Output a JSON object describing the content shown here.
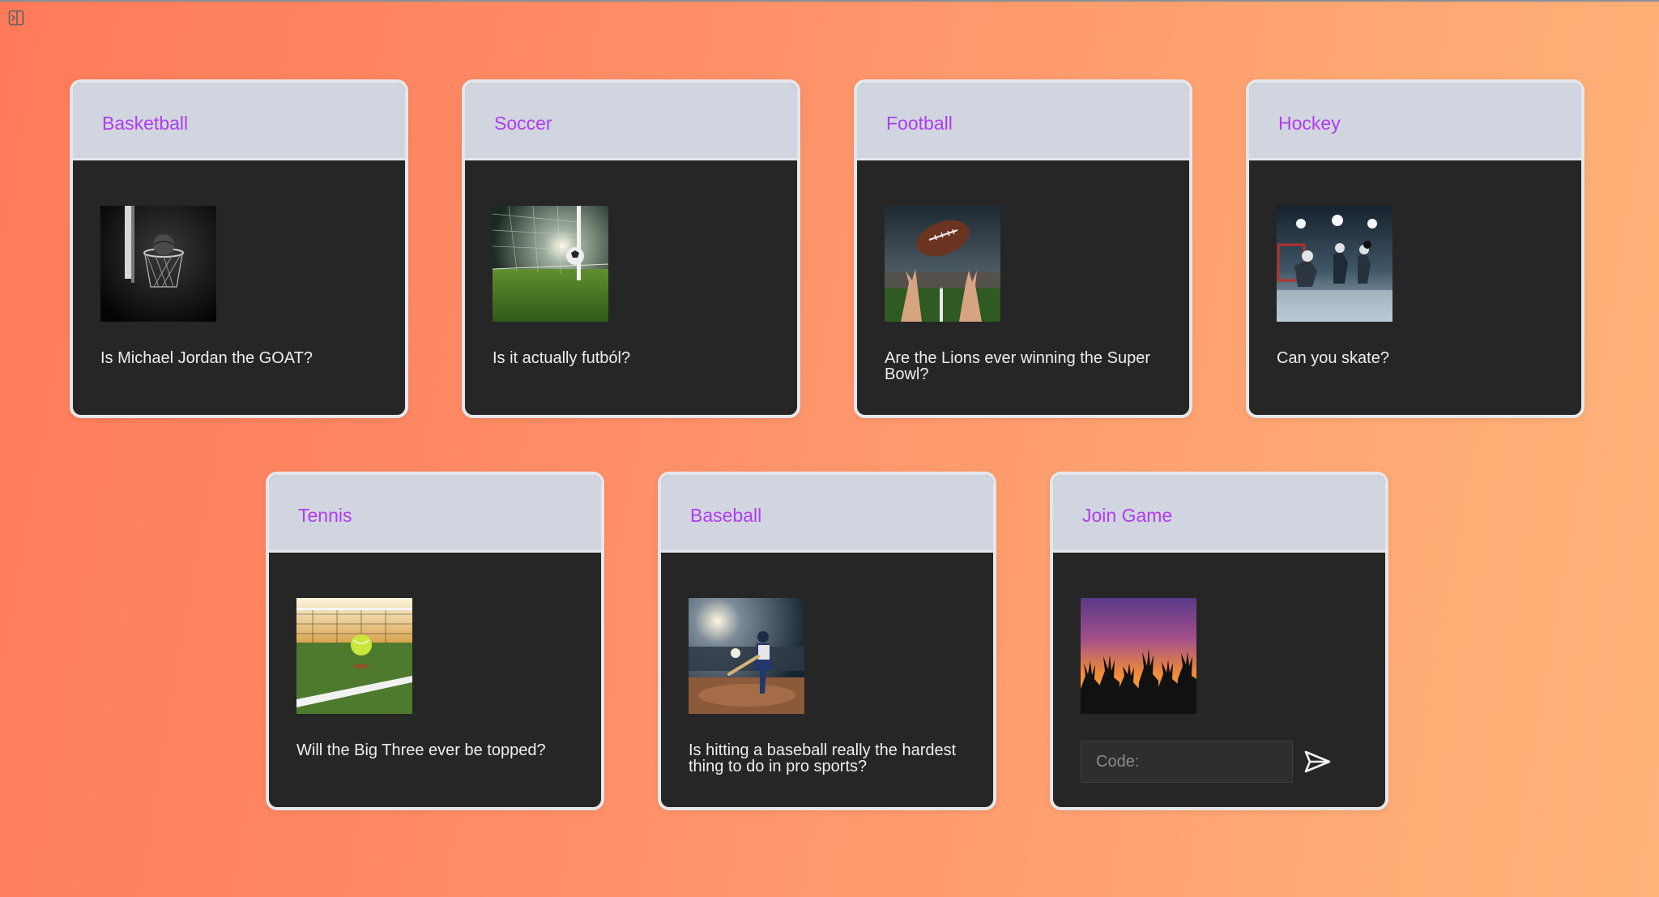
{
  "colors": {
    "accent_title": "#b13cf2",
    "card_body": "#262626",
    "card_header": "#d1d5df",
    "card_border": "#e5e7eb",
    "background_start": "#ff7a59",
    "background_end": "#ffb379"
  },
  "toolbar": {
    "sidebar_toggle_icon": "sidebar-toggle-icon"
  },
  "cards": [
    {
      "title": "Basketball",
      "question": "Is Michael Jordan the GOAT?",
      "image": "basketball-hoop-image"
    },
    {
      "title": "Soccer",
      "question": "Is it actually futból?",
      "image": "soccer-goal-image"
    },
    {
      "title": "Football",
      "question": "Are the Lions ever winning the Super Bowl?",
      "image": "football-stadium-image"
    },
    {
      "title": "Hockey",
      "question": "Can you skate?",
      "image": "hockey-rink-image"
    },
    {
      "title": "Tennis",
      "question": "Will the Big Three ever be topped?",
      "image": "tennis-ball-court-image"
    },
    {
      "title": "Baseball",
      "question": "Is hitting a baseball really the hardest thing to do in pro sports?",
      "image": "baseball-batter-image"
    }
  ],
  "join": {
    "title": "Join Game",
    "image": "crowd-sunset-image",
    "code_placeholder": "Code:",
    "send_icon": "send-icon"
  }
}
